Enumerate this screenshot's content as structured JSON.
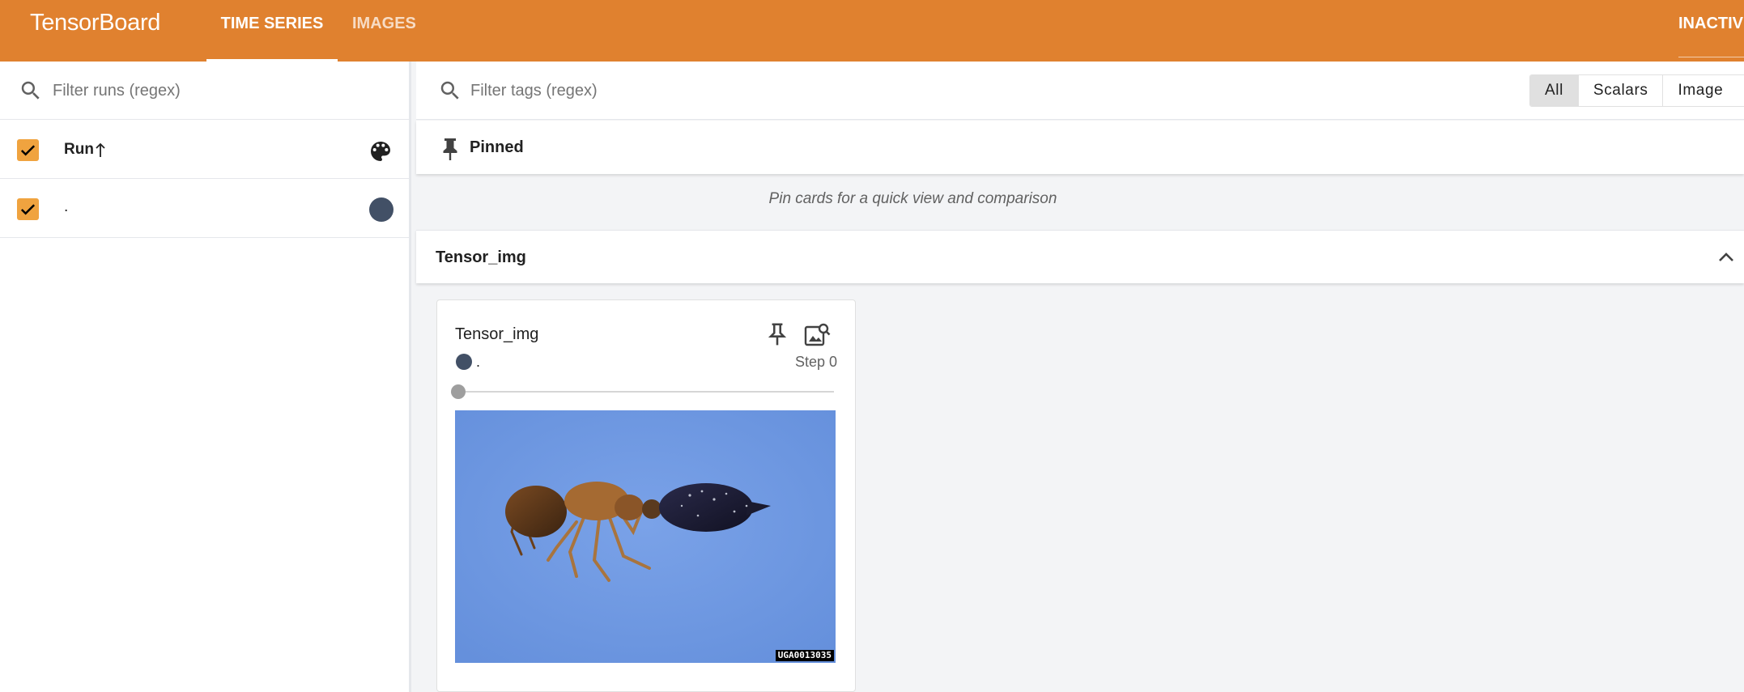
{
  "header": {
    "brand": "TensorBoard",
    "tabs": [
      {
        "label": "TIME SERIES",
        "active": true
      },
      {
        "label": "IMAGES",
        "active": false
      }
    ],
    "inactive_label": "INACTIV",
    "bar_color": "#e0812f"
  },
  "sidebar": {
    "filter": {
      "placeholder": "Filter runs (regex)",
      "value": ""
    },
    "column_header": {
      "label": "Run",
      "sort": "ascending",
      "checked": true
    },
    "runs": [
      {
        "name": ".",
        "checked": true,
        "color": "#425066"
      }
    ]
  },
  "main": {
    "filter": {
      "placeholder": "Filter tags (regex)",
      "value": ""
    },
    "type_filters": [
      {
        "label": "All",
        "active": true
      },
      {
        "label": "Scalars",
        "active": false
      },
      {
        "label": "Image",
        "active": false
      }
    ],
    "pinned": {
      "title": "Pinned",
      "empty_message": "Pin cards for a quick view and comparison"
    },
    "group": {
      "title": "Tensor_img",
      "expanded": true,
      "cards": [
        {
          "title": "Tensor_img",
          "run_name": ".",
          "run_color": "#425066",
          "step_label": "Step 0",
          "step_fraction": 0,
          "image_tag": "UGA0013035"
        }
      ]
    }
  }
}
